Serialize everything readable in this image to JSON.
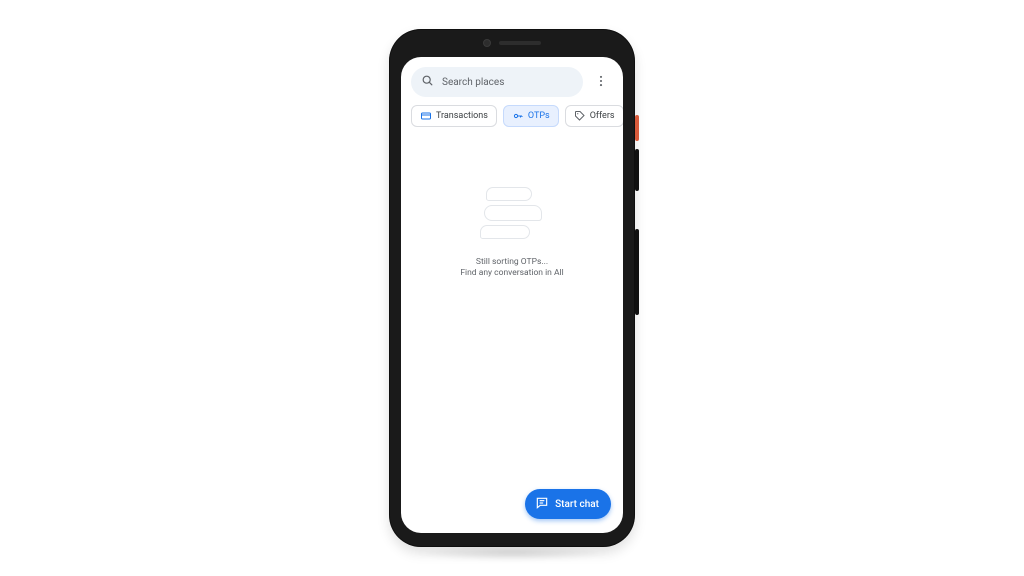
{
  "search": {
    "placeholder": "Search places"
  },
  "chips": {
    "transactions": "Transactions",
    "otps": "OTPs",
    "offers": "Offers"
  },
  "empty": {
    "line1": "Still sorting OTPs...",
    "line2": "Find any conversation in All"
  },
  "fab": {
    "label": "Start chat"
  },
  "colors": {
    "accent": "#1a73e8"
  }
}
